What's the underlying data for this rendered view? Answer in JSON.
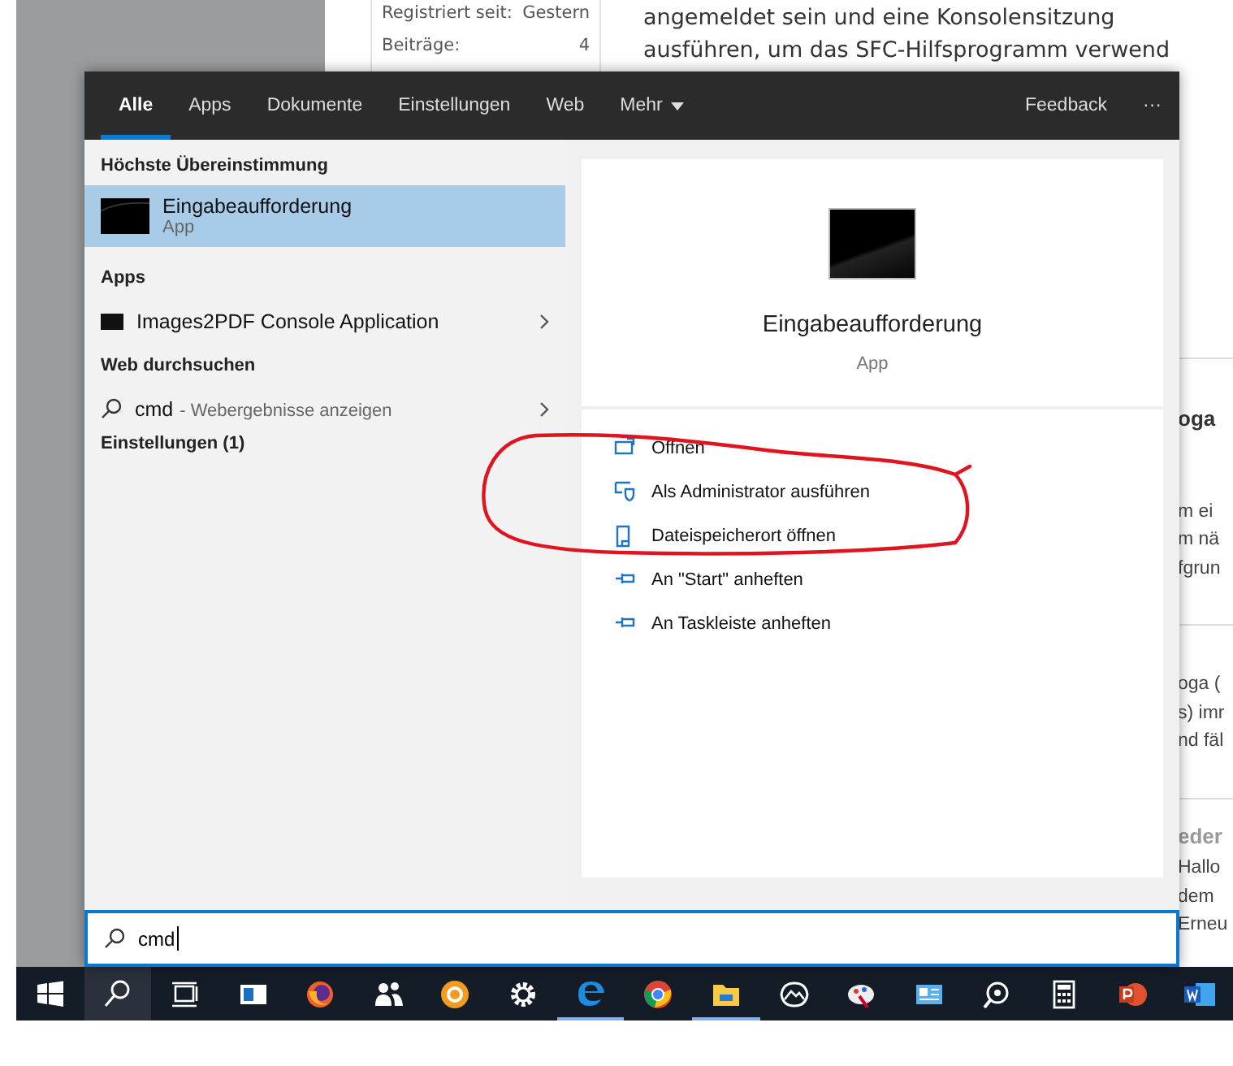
{
  "background_page": {
    "profile": [
      {
        "label": "Registriert seit:",
        "value": "Gestern"
      },
      {
        "label": "Beiträge:",
        "value": "4"
      }
    ],
    "post_lines": [
      "angemeldet sein und eine Konsolensitzung",
      "ausführen, um das SFC-Hilfsprogramm verwend"
    ],
    "side_cards": [
      {
        "title": "oga",
        "lines": [
          "m ei",
          "m nä",
          "fgrun"
        ]
      },
      {
        "lines": [
          "oga (",
          "s) imr",
          "nd fäl"
        ]
      },
      {
        "title": "eder",
        "lines": [
          "Hallo",
          "dem",
          "Erneu"
        ]
      }
    ]
  },
  "search_panel": {
    "tabs": [
      {
        "label": "Alle",
        "selected": true
      },
      {
        "label": "Apps",
        "selected": false
      },
      {
        "label": "Dokumente",
        "selected": false
      },
      {
        "label": "Einstellungen",
        "selected": false
      },
      {
        "label": "Web",
        "selected": false
      }
    ],
    "more_tab": "Mehr",
    "feedback": "Feedback",
    "overflow": "···",
    "sections": [
      {
        "heading": "Höchste Übereinstimmung",
        "items": [
          {
            "kind": "app",
            "title": "Eingabeaufforderung",
            "subtitle": "App",
            "selected": true,
            "expandable": false
          }
        ]
      },
      {
        "heading": "Apps",
        "items": [
          {
            "kind": "app",
            "title": "Images2PDF Console Application",
            "selected": false,
            "expandable": true
          }
        ]
      },
      {
        "heading": "Web durchsuchen",
        "items": [
          {
            "kind": "web",
            "title": "cmd",
            "subtitle": "- Webergebnisse anzeigen",
            "selected": false,
            "expandable": true
          }
        ]
      },
      {
        "heading": "Einstellungen (1)"
      }
    ],
    "detail": {
      "title": "Eingabeaufforderung",
      "subtitle": "App",
      "actions": [
        {
          "kind": "open",
          "label": "Öffnen"
        },
        {
          "kind": "admin",
          "label": "Als Administrator ausführen"
        },
        {
          "kind": "folder",
          "label": "Dateispeicherort öffnen"
        },
        {
          "kind": "pin",
          "label": "An \"Start\" anheften"
        },
        {
          "kind": "pin",
          "label": "An Taskleiste anheften"
        }
      ]
    },
    "search_box": {
      "value": "cmd"
    }
  },
  "taskbar": {
    "items": [
      {
        "kind": "windows",
        "selected": false,
        "running": false
      },
      {
        "kind": "search",
        "selected": true,
        "running": false
      },
      {
        "kind": "taskview",
        "selected": false,
        "running": false
      },
      {
        "kind": "news",
        "selected": false,
        "running": false
      },
      {
        "kind": "firefox",
        "selected": false,
        "running": false
      },
      {
        "kind": "people",
        "selected": false,
        "running": false
      },
      {
        "kind": "orange",
        "selected": false,
        "running": false
      },
      {
        "kind": "settings",
        "selected": false,
        "running": false
      },
      {
        "kind": "edge",
        "selected": false,
        "running": true
      },
      {
        "kind": "chrome",
        "selected": false,
        "running": false
      },
      {
        "kind": "explorer",
        "selected": false,
        "running": true
      },
      {
        "kind": "photos",
        "selected": false,
        "running": false
      },
      {
        "kind": "paint",
        "selected": false,
        "running": false
      },
      {
        "kind": "mail",
        "selected": false,
        "running": false
      },
      {
        "kind": "speaker",
        "selected": false,
        "running": false
      },
      {
        "kind": "calculator",
        "selected": false,
        "running": false
      },
      {
        "kind": "powerpoint",
        "selected": false,
        "running": false
      },
      {
        "kind": "word",
        "selected": false,
        "running": false
      }
    ]
  }
}
